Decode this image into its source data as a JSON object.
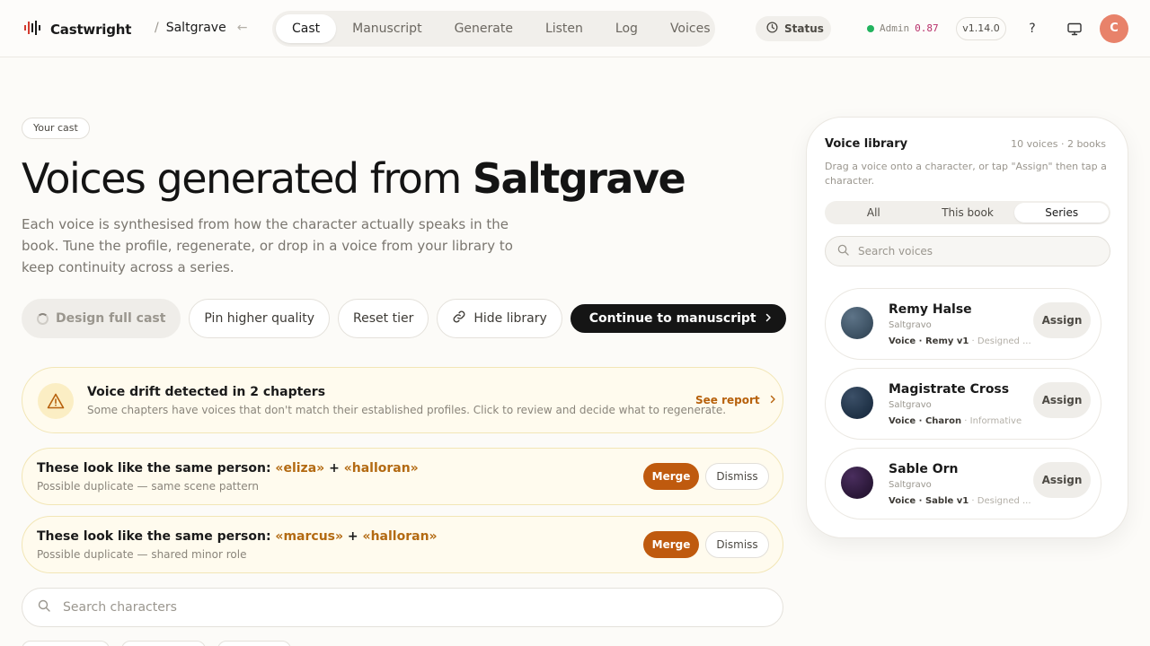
{
  "app": {
    "brand": "Castwright",
    "project": "Saltgrave",
    "crumb_sep": "/"
  },
  "nav": {
    "tabs": [
      "Cast",
      "Manuscript",
      "Generate",
      "Listen",
      "Log",
      "Voices"
    ],
    "active_tab": "Cast"
  },
  "topbar": {
    "status_label": "Status",
    "admin_label": "Admin",
    "admin_value": "0.87",
    "version": "v1.14.0",
    "help": "?",
    "avatar_initial": "C"
  },
  "hero": {
    "eyebrow": "Your cast",
    "headline_prefix": "Voices generated from ",
    "headline_bold": "Saltgrave",
    "subtext": "Each voice is synthesised from how the character actually speaks in the book. Tune the profile, regenerate, or drop in a voice from your library to keep continuity across a series."
  },
  "actions": {
    "design_full_cast": "Design full cast",
    "pin_higher_quality": "Pin higher quality",
    "reset_tier": "Reset tier",
    "hide_library": "Hide library",
    "continue": "Continue to manuscript"
  },
  "drift_alert": {
    "title": "Voice drift detected in 2 chapters",
    "description": "Some chapters have voices that don't match their established profiles. Click to review and decide what to regenerate.",
    "link": "See report"
  },
  "duplicates": [
    {
      "title_prefix": "These look like the same person: ",
      "name_a": "«eliza»",
      "joiner": " + ",
      "name_b": "«halloran»",
      "description": "Possible duplicate — same scene pattern",
      "merge": "Merge",
      "dismiss": "Dismiss"
    },
    {
      "title_prefix": "These look like the same person: ",
      "name_a": "«marcus»",
      "joiner": " + ",
      "name_b": "«halloran»",
      "description": "Possible duplicate — shared minor role",
      "merge": "Merge",
      "dismiss": "Dismiss"
    }
  ],
  "character_search": {
    "placeholder": "Search characters"
  },
  "library": {
    "title": "Voice library",
    "count": "10 voices · 2 books",
    "help": "Drag a voice onto a character, or tap \"Assign\" then tap a character.",
    "tabs": [
      "All",
      "This book",
      "Series"
    ],
    "active_tab": "Series",
    "search_placeholder": "Search voices",
    "voices": [
      {
        "name": "Remy Halse",
        "book": "Saltgravo",
        "voice": "Voice · Remy v1",
        "note": " · Designed ...",
        "assign": "Assign",
        "color": "#3f5466"
      },
      {
        "name": "Magistrate Cross",
        "book": "Saltgravo",
        "voice": "Voice · Charon",
        "note": " · Informative",
        "assign": "Assign",
        "color": "#22354a"
      },
      {
        "name": "Sable Orn",
        "book": "Saltgravo",
        "voice": "Voice · Sable v1",
        "note": " · Designed ...",
        "assign": "Assign",
        "color": "#2e1a3c"
      }
    ]
  },
  "colors": {
    "accent": "#bf5a0e",
    "warning_bg": "#fffbee",
    "status_ok": "#22b35e",
    "admin_value": "#b8306a",
    "avatar": "#e8826a"
  }
}
